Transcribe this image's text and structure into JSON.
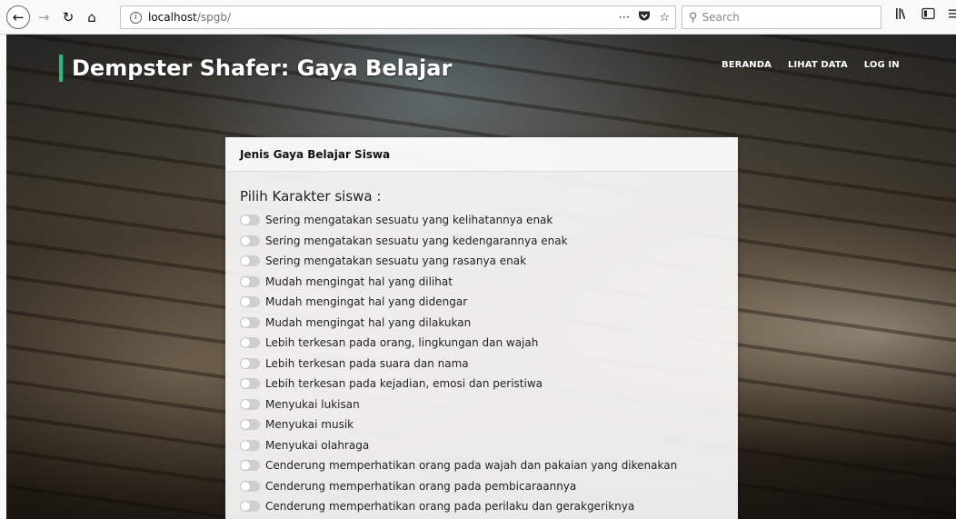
{
  "browser": {
    "url_host": "localhost",
    "url_path": "/spgb/",
    "search_placeholder": "Search",
    "icons": {
      "back": "back-arrow-icon",
      "forward": "forward-arrow-icon",
      "reload": "reload-icon",
      "home": "home-icon",
      "info": "info-icon",
      "more": "more-actions-icon",
      "pocket": "pocket-icon",
      "bookmark": "bookmark-star-icon",
      "search": "search-icon",
      "library": "library-icon",
      "sidebar": "sidebar-icon",
      "menu": "hamburger-menu-icon"
    }
  },
  "site": {
    "brand": "Dempster Shafer: Gaya Belajar",
    "accent_color": "#1fbe7d",
    "nav": [
      {
        "label": "BERANDA"
      },
      {
        "label": "LIHAT DATA"
      },
      {
        "label": "LOG IN"
      }
    ]
  },
  "card": {
    "title": "Jenis Gaya Belajar Siswa",
    "section_title": "Pilih Karakter siswa :",
    "options": [
      {
        "label": "Sering mengatakan sesuatu yang kelihatannya enak",
        "checked": false
      },
      {
        "label": "Sering mengatakan sesuatu yang kedengarannya enak",
        "checked": false
      },
      {
        "label": "Sering mengatakan sesuatu yang rasanya enak",
        "checked": false
      },
      {
        "label": "Mudah mengingat hal yang dilihat",
        "checked": false
      },
      {
        "label": "Mudah mengingat hal yang didengar",
        "checked": false
      },
      {
        "label": "Mudah mengingat hal yang dilakukan",
        "checked": false
      },
      {
        "label": "Lebih terkesan pada orang, lingkungan dan wajah",
        "checked": false
      },
      {
        "label": "Lebih terkesan pada suara dan nama",
        "checked": false
      },
      {
        "label": "Lebih terkesan pada kejadian, emosi dan peristiwa",
        "checked": false
      },
      {
        "label": "Menyukai lukisan",
        "checked": false
      },
      {
        "label": "Menyukai musik",
        "checked": false
      },
      {
        "label": "Menyukai olahraga",
        "checked": false
      },
      {
        "label": "Cenderung memperhatikan orang pada wajah dan pakaian yang dikenakan",
        "checked": false
      },
      {
        "label": "Cenderung memperhatikan orang pada pembicaraannya",
        "checked": false
      },
      {
        "label": "Cenderung memperhatikan orang pada perilaku dan gerakgeriknya",
        "checked": false
      }
    ]
  }
}
